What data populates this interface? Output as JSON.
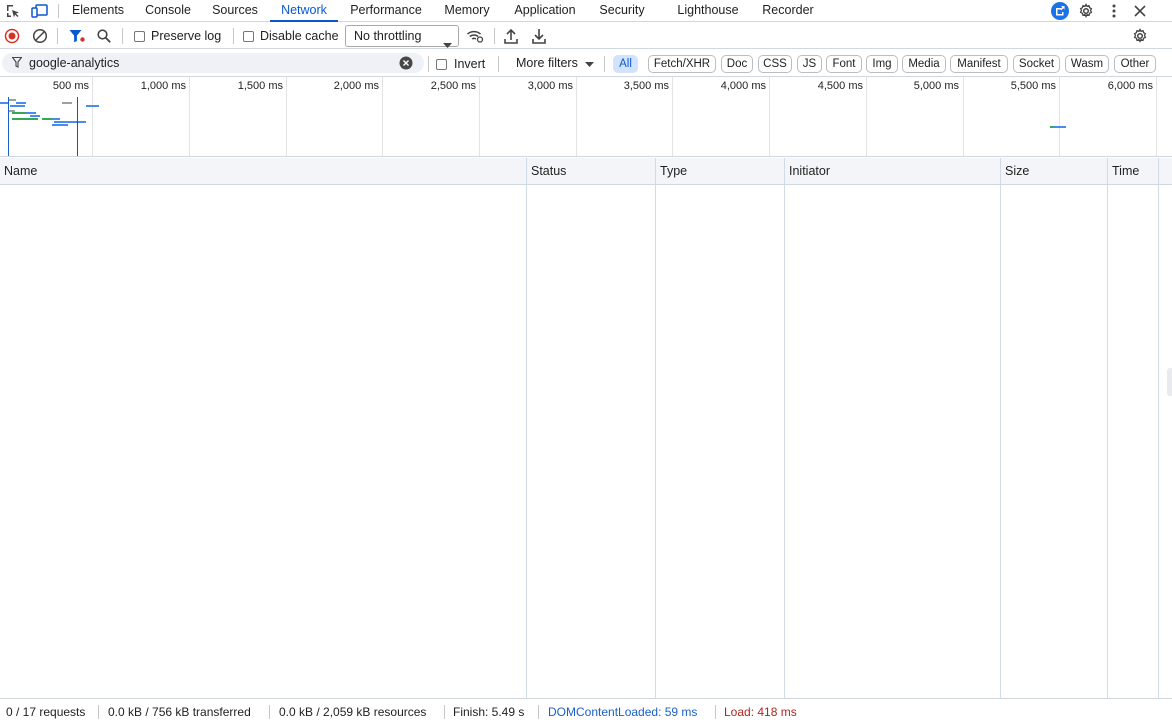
{
  "tabs": [
    {
      "label": "Elements"
    },
    {
      "label": "Console"
    },
    {
      "label": "Sources"
    },
    {
      "label": "Network",
      "active": true
    },
    {
      "label": "Performance"
    },
    {
      "label": "Memory"
    },
    {
      "label": "Application"
    },
    {
      "label": "Security"
    },
    {
      "label": "Lighthouse"
    },
    {
      "label": "Recorder"
    }
  ],
  "toolbar": {
    "preserve_log": "Preserve log",
    "disable_cache": "Disable cache",
    "throttling": "No throttling"
  },
  "filter": {
    "query": "google-analytics",
    "invert": "Invert",
    "more_filters": "More filters",
    "types": [
      "All",
      "Fetch/XHR",
      "Doc",
      "CSS",
      "JS",
      "Font",
      "Img",
      "Media",
      "Manifest",
      "Socket",
      "Wasm",
      "Other"
    ]
  },
  "overview": {
    "ticks": [
      "500 ms",
      "1,000 ms",
      "1,500 ms",
      "2,000 ms",
      "2,500 ms",
      "3,000 ms",
      "3,500 ms",
      "4,000 ms",
      "4,500 ms",
      "5,000 ms",
      "5,500 ms",
      "6,000 ms"
    ]
  },
  "table": {
    "columns": [
      "Name",
      "Status",
      "Type",
      "Initiator",
      "Size",
      "Time"
    ],
    "rows": []
  },
  "status": {
    "requests": "0 / 17 requests",
    "transferred": "0.0 kB / 756 kB transferred",
    "resources": "0.0 kB / 2,059 kB resources",
    "finish": "Finish: 5.49 s",
    "dom_content_loaded": "DOMContentLoaded: 59 ms",
    "load": "Load: 418 ms"
  },
  "colors": {
    "accent": "#0b57d0",
    "record": "#d93025",
    "dcl": "#1a5fcc",
    "load": "#b3261e"
  },
  "icons": {
    "inspect": "inspect-element-icon",
    "device": "device-toolbar-icon",
    "record": "record-icon",
    "clear": "clear-icon",
    "filter": "filter-icon",
    "search": "search-icon",
    "wifi": "network-conditions-icon",
    "import": "import-har-icon",
    "export": "export-har-icon",
    "settings": "settings-icon"
  }
}
